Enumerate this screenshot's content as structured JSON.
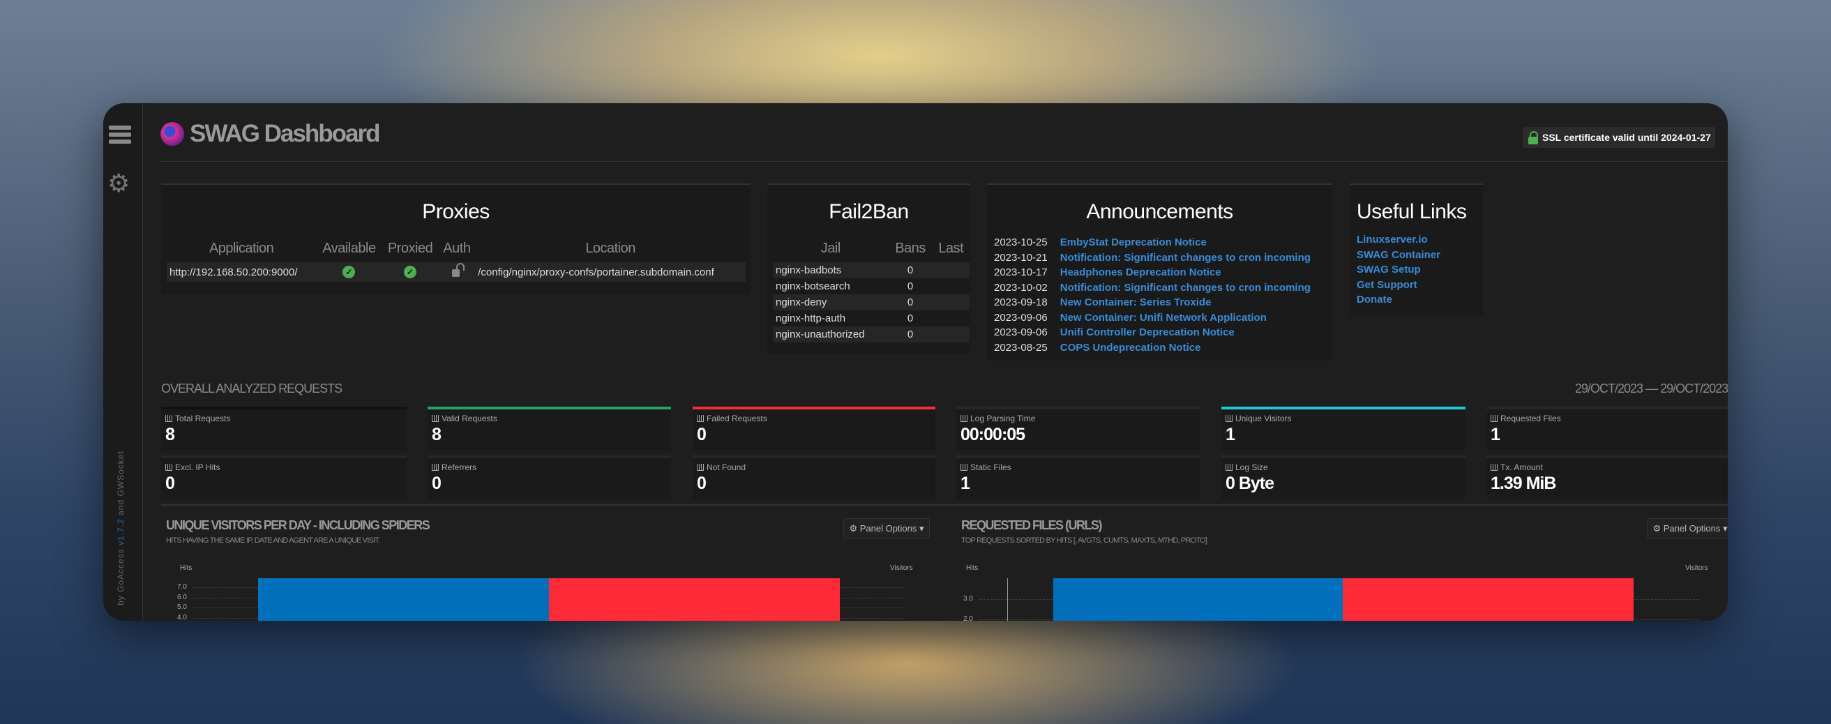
{
  "header": {
    "title": "SWAG Dashboard",
    "ssl": "SSL certificate valid until 2024-01-27"
  },
  "sidebar": {
    "credit_by": "by GoAccess",
    "credit_version": "v1.7.2",
    "credit_and": "and GWSocket"
  },
  "proxies": {
    "title": "Proxies",
    "columns": [
      "Application",
      "Available",
      "Proxied",
      "Auth",
      "Location"
    ],
    "rows": [
      {
        "application": "http://192.168.50.200:9000/",
        "available": true,
        "proxied": true,
        "auth": "unlocked",
        "location": "/config/nginx/proxy-confs/portainer.subdomain.conf"
      }
    ]
  },
  "fail2ban": {
    "title": "Fail2Ban",
    "columns": [
      "Jail",
      "Bans",
      "Last"
    ],
    "rows": [
      {
        "jail": "nginx-badbots",
        "bans": "0",
        "last": ""
      },
      {
        "jail": "nginx-botsearch",
        "bans": "0",
        "last": ""
      },
      {
        "jail": "nginx-deny",
        "bans": "0",
        "last": ""
      },
      {
        "jail": "nginx-http-auth",
        "bans": "0",
        "last": ""
      },
      {
        "jail": "nginx-unauthorized",
        "bans": "0",
        "last": ""
      }
    ]
  },
  "announcements": {
    "title": "Announcements",
    "items": [
      {
        "date": "2023-10-25",
        "text": "EmbyStat Deprecation Notice"
      },
      {
        "date": "2023-10-21",
        "text": "Notification: Significant changes to cron incoming"
      },
      {
        "date": "2023-10-17",
        "text": "Headphones Deprecation Notice"
      },
      {
        "date": "2023-10-02",
        "text": "Notification: Significant changes to cron incoming"
      },
      {
        "date": "2023-09-18",
        "text": "New Container: Series Troxide"
      },
      {
        "date": "2023-09-06",
        "text": "New Container: Unifi Network Application"
      },
      {
        "date": "2023-09-06",
        "text": "Unifi Controller Deprecation Notice"
      },
      {
        "date": "2023-08-25",
        "text": "COPS Undeprecation Notice"
      }
    ]
  },
  "links": {
    "title": "Useful Links",
    "items": [
      "Linuxserver.io",
      "SWAG Container",
      "SWAG Setup",
      "Get Support",
      "Donate"
    ]
  },
  "overall": {
    "title": "OVERALL ANALYZED REQUESTS",
    "date_range": "29/OCT/2023 — 29/OCT/2023",
    "cards": [
      {
        "label": "Total Requests",
        "value": "8",
        "accent": "#111111"
      },
      {
        "label": "Valid Requests",
        "value": "8",
        "accent": "#26a269"
      },
      {
        "label": "Failed Requests",
        "value": "0",
        "accent": "#ff2a38"
      },
      {
        "label": "Log Parsing Time",
        "value": "00:00:05",
        "accent": "#272727"
      },
      {
        "label": "Unique Visitors",
        "value": "1",
        "accent": "#1bc8d8"
      },
      {
        "label": "Requested Files",
        "value": "1",
        "accent": "#272727"
      },
      {
        "label": "Excl. IP Hits",
        "value": "0"
      },
      {
        "label": "Referrers",
        "value": "0"
      },
      {
        "label": "Not Found",
        "value": "0"
      },
      {
        "label": "Static Files",
        "value": "1"
      },
      {
        "label": "Log Size",
        "value": "0 Byte"
      },
      {
        "label": "Tx. Amount",
        "value": "1.39 MiB"
      }
    ]
  },
  "panels": [
    {
      "title": "UNIQUE VISITORS PER DAY - INCLUDING SPIDERS",
      "subtitle": "HITS HAVING THE SAME IP, DATE AND AGENT ARE A UNIQUE VISIT.",
      "options": "Panel Options",
      "y_left": "Hits",
      "y_right": "Visitors",
      "ticks": [
        "7.0",
        "6.0",
        "5.0",
        "4.0"
      ]
    },
    {
      "title": "REQUESTED FILES (URLS)",
      "subtitle": "TOP REQUESTS SORTED BY HITS [, AVGTS, CUMTS, MAXTS, MTHD, PROTO]",
      "options": "Panel Options",
      "y_left": "Hits",
      "y_right": "Visitors",
      "ticks": [
        "3.0",
        "2.0"
      ]
    }
  ],
  "colors": {
    "hits": "#0070ba",
    "visitors": "#ff2a38",
    "link": "#3a8bd6",
    "ok": "#4caf50"
  }
}
